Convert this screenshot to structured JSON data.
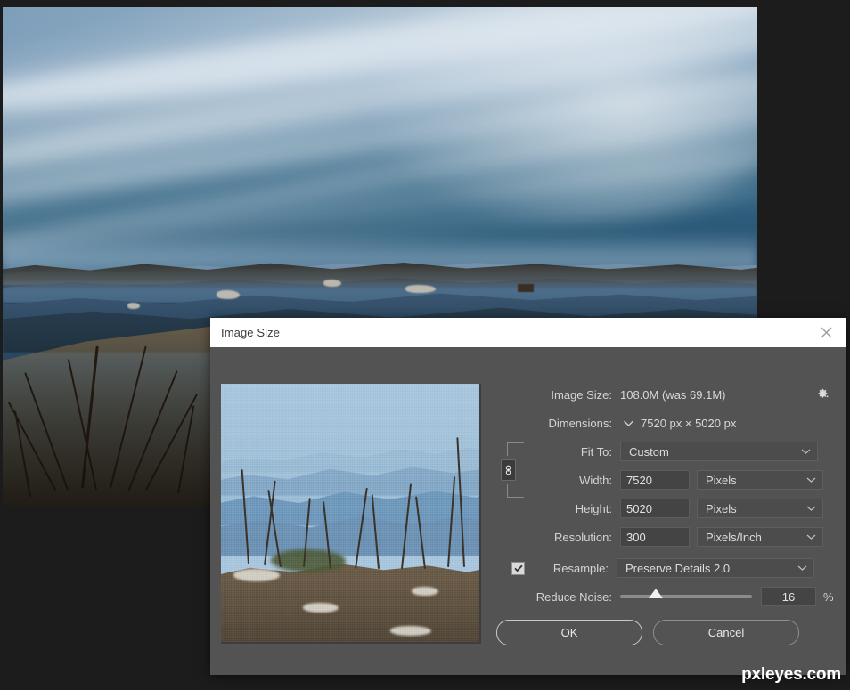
{
  "dialog": {
    "title": "Image Size",
    "close_icon": "close-icon",
    "image_size_label": "Image Size:",
    "image_size_value": "108.0M (was 69.1M)",
    "gear_icon": "gear-icon",
    "dimensions_label": "Dimensions:",
    "dimensions_caret_icon": "chevron-down-icon",
    "dimensions_value": "7520 px  ×  5020 px",
    "fit_to_label": "Fit To:",
    "fit_to_value": "Custom",
    "width_label": "Width:",
    "width_value": "7520",
    "width_unit": "Pixels",
    "height_label": "Height:",
    "height_value": "5020",
    "height_unit": "Pixels",
    "link_icon": "link-chain-icon",
    "resolution_label": "Resolution:",
    "resolution_value": "300",
    "resolution_unit": "Pixels/Inch",
    "resample_label": "Resample:",
    "resample_checked": true,
    "resample_value": "Preserve Details 2.0",
    "reduce_noise_label": "Reduce Noise:",
    "reduce_noise_value": "16",
    "reduce_noise_unit": "%",
    "reduce_noise_percent": 27,
    "ok_label": "OK",
    "cancel_label": "Cancel",
    "chevron_icon": "chevron-down-icon"
  },
  "watermark": {
    "text": "pxleyes.com"
  },
  "photo": {
    "alt": "mountain-overlook-landscape-photo"
  },
  "preview": {
    "alt": "image-size-preview-thumbnail"
  }
}
